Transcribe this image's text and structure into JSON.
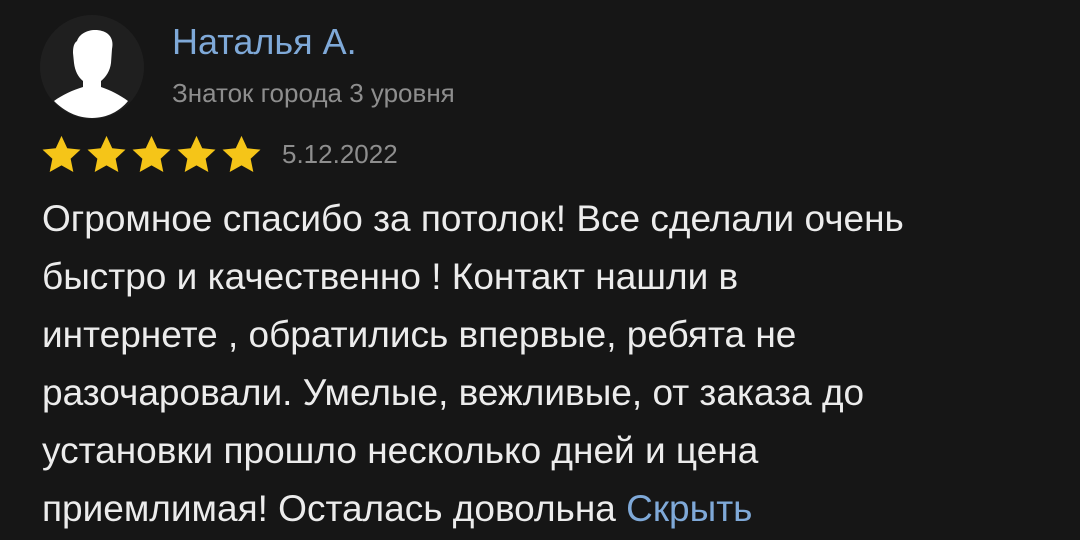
{
  "author": {
    "name": "Наталья А.",
    "level": "Знаток города 3 уровня",
    "avatar_icon": "user-silhouette-icon"
  },
  "rating": {
    "stars": 5,
    "max": 5,
    "star_icon": "star-icon",
    "star_color": "#f5c518"
  },
  "date": "5.12.2022",
  "review": {
    "lines": [
      "Огромное спасибо за потолок! Все сделали очень",
      "быстро и качественно ! Контакт нашли в",
      "интернете , обратились впервые, ребята не",
      "разочаровали. Умелые, вежливые, от заказа до",
      "установки прошло несколько дней и цена",
      "приемлимая! Осталась довольна"
    ],
    "hide_label": "Скрыть"
  },
  "colors": {
    "background": "#161616",
    "link": "#7fa9d8",
    "text": "#ececec",
    "muted": "#8e8e8e"
  }
}
